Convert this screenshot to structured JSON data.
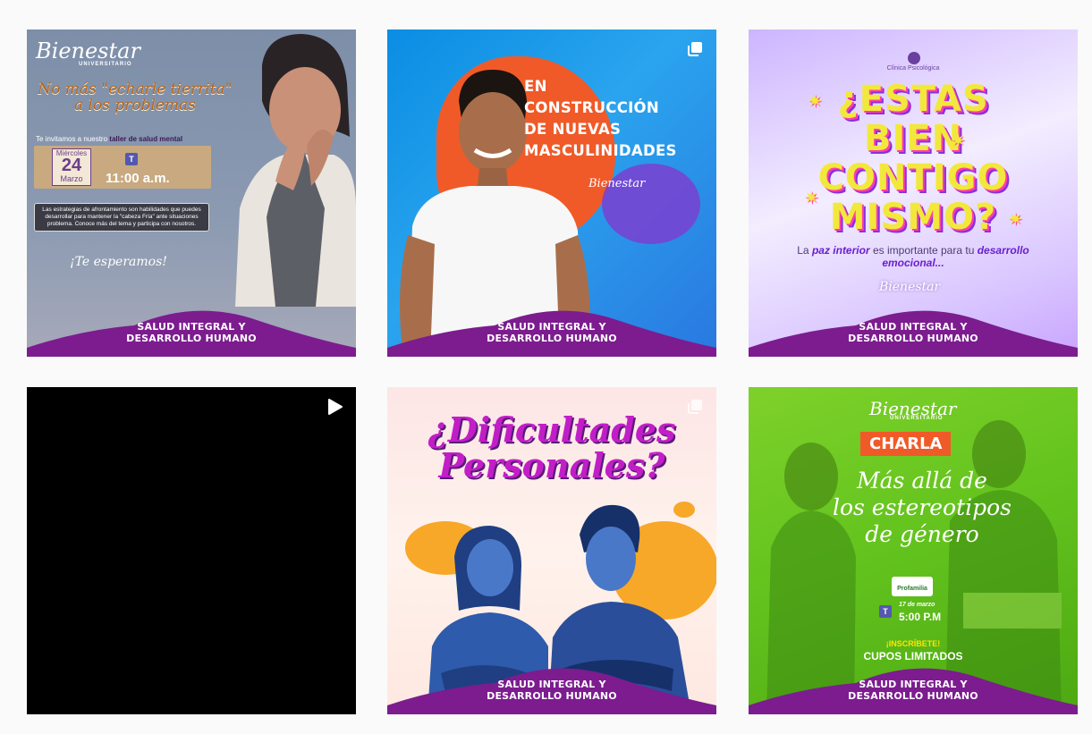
{
  "colors": {
    "page_bg": "#fafafa",
    "footer_purple": "#7c1c8f",
    "icon_white": "#ffffff"
  },
  "posts": [
    {
      "type_icon": "none",
      "logo": "Bienestar",
      "logo_sub": "UNIVERSITARIO",
      "headline": "No más \"echarle tierrita\" a los problemas",
      "invite_prefix": "Te invitamos a nuestro",
      "invite_bold": "taller de salud mental",
      "day_name": "Miércoles",
      "day_num": "24",
      "month": "Marzo",
      "time": "11:00 a.m.",
      "strategies": "Las estrategias de afrontamiento son habilidades que puedes desarrollar para mantener la \"cabeza Fría\" ante situaciones problema. Conoce más del tema y participa con nosotros.",
      "closing": "¡Te esperamos!",
      "footer_line1": "SALUD INTEGRAL Y",
      "footer_line2": "DESARROLLO HUMANO"
    },
    {
      "type_icon": "carousel-icon",
      "title_lines": [
        "EN",
        "CONSTRUCCIÓN",
        "DE NUEVAS",
        "MASCULINIDADES"
      ],
      "logo": "Bienestar",
      "footer_line1": "SALUD INTEGRAL Y",
      "footer_line2": "DESARROLLO HUMANO"
    },
    {
      "type_icon": "none",
      "logo_text": "Clínica Psicológica",
      "title_lines": [
        "¿ESTAS",
        "BIEN",
        "CONTIGO",
        "MISMO?"
      ],
      "sub_1": "La",
      "sub_bold_1": "paz interior",
      "sub_2": "es importante para tu",
      "sub_bold_2": "desarrollo emocional...",
      "logo": "Bienestar",
      "footer_line1": "SALUD INTEGRAL Y",
      "footer_line2": "DESARROLLO HUMANO"
    },
    {
      "type_icon": "video-play-icon"
    },
    {
      "type_icon": "carousel-icon",
      "title_lines": [
        "¿Dificultades",
        "Personales?"
      ],
      "footer_line1": "SALUD INTEGRAL Y",
      "footer_line2": "DESARROLLO HUMANO"
    },
    {
      "type_icon": "none",
      "logo": "Bienestar",
      "logo_sub": "UNIVERSITARIO",
      "badge": "CHARLA",
      "script_lines": [
        "Más allá de",
        "los estereotipos",
        "de género"
      ],
      "partner": "Profamilia",
      "date": "17 de marzo",
      "time": "5:00 P.M",
      "cta": "¡INSCRÍBETE!",
      "cupos": "CUPOS LIMITADOS",
      "footer_line1": "SALUD INTEGRAL Y",
      "footer_line2": "DESARROLLO HUMANO"
    }
  ]
}
